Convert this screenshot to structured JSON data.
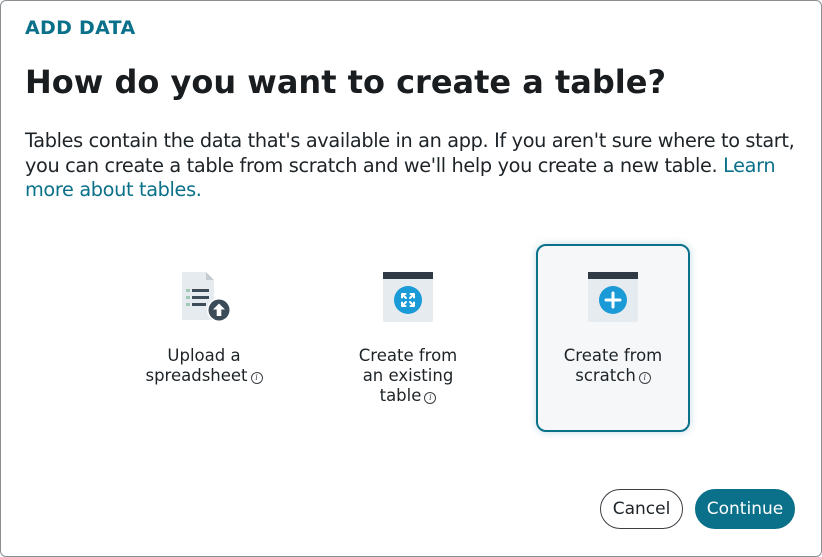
{
  "dialog": {
    "eyebrow": "ADD DATA",
    "title": "How do you want to create a table?",
    "description": "Tables contain the data that's available in an app. If you aren't sure where to start, you can create a table from scratch and we'll help you create a new table.",
    "learn_more_link": "Learn more about tables."
  },
  "options": [
    {
      "label": "Upload a\nspreadsheet",
      "icon": "spreadsheet-upload-icon",
      "selected": false
    },
    {
      "label": "Create from\nan existing\ntable",
      "icon": "table-expand-icon",
      "selected": false
    },
    {
      "label": "Create from\nscratch",
      "icon": "table-add-icon",
      "selected": true
    }
  ],
  "buttons": {
    "cancel_label": "Cancel",
    "continue_label": "Continue"
  },
  "colors": {
    "accent": "#0b7089",
    "icon_blue": "#1a9ad6",
    "icon_dark": "#2f3a45",
    "icon_panel": "#e6ebef"
  }
}
